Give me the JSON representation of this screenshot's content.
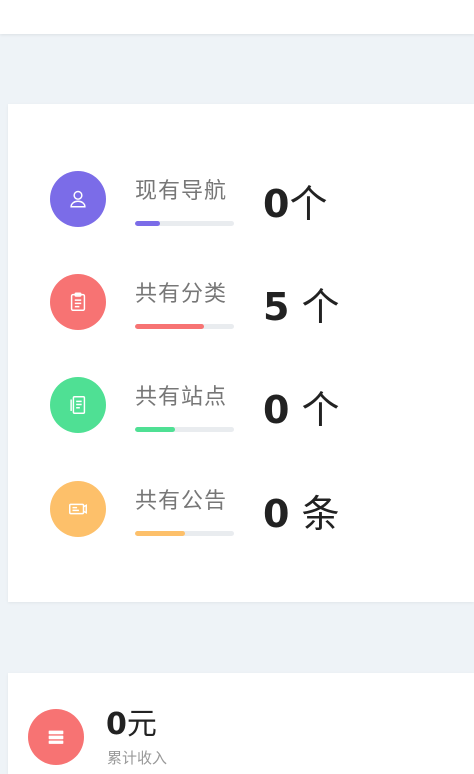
{
  "stats": [
    {
      "label": "现有导航",
      "value": "0",
      "unit": "个",
      "value_text": "0个",
      "color": "#7b6ce8",
      "progress": 0.25,
      "icon": "user-icon"
    },
    {
      "label": "共有分类",
      "value": "5",
      "unit": "个",
      "value_text": "5 个",
      "color": "#f77373",
      "progress": 0.7,
      "icon": "clipboard-icon"
    },
    {
      "label": "共有站点",
      "value": "0",
      "unit": "个",
      "value_text": "0 个",
      "color": "#4fe094",
      "progress": 0.4,
      "icon": "document-icon"
    },
    {
      "label": "共有公告",
      "value": "0",
      "unit": "条",
      "value_text": "0 条",
      "color": "#fdc06a",
      "progress": 0.5,
      "icon": "ticket-icon"
    }
  ],
  "income": {
    "value": "0",
    "unit": "元",
    "label": "累计收入",
    "color": "#f77373",
    "icon": "wallet-icon"
  }
}
